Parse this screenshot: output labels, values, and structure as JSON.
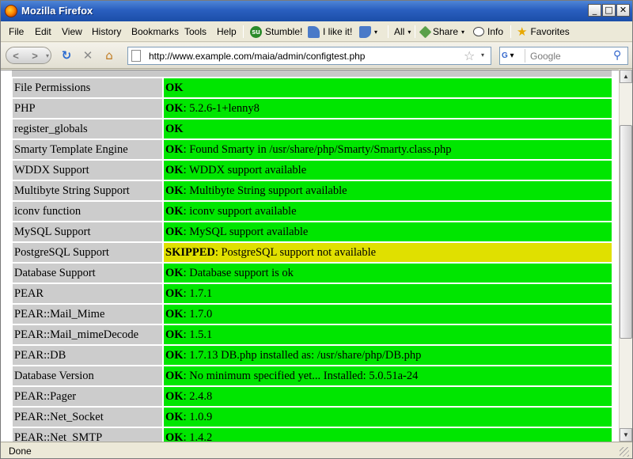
{
  "window": {
    "title": "Mozilla Firefox"
  },
  "menu": [
    "File",
    "Edit",
    "View",
    "History",
    "Bookmarks",
    "Tools",
    "Help"
  ],
  "toolbar": {
    "stumble": "Stumble!",
    "ilike": "I like it!",
    "all": "All",
    "share": "Share",
    "info": "Info",
    "favorites": "Favorites"
  },
  "nav": {
    "url": "http://www.example.com/maia/admin/configtest.php",
    "search_placeholder": "Google",
    "search_engine": "G"
  },
  "config_rows": [
    {
      "name": "File Permissions",
      "status": "OK",
      "detail": ""
    },
    {
      "name": "PHP",
      "status": "OK",
      "detail": ": 5.2.6-1+lenny8"
    },
    {
      "name": "register_globals",
      "status": "OK",
      "detail": ""
    },
    {
      "name": "Smarty Template Engine",
      "status": "OK",
      "detail": ": Found Smarty in /usr/share/php/Smarty/Smarty.class.php"
    },
    {
      "name": "WDDX Support",
      "status": "OK",
      "detail": ": WDDX support available"
    },
    {
      "name": "Multibyte String Support",
      "status": "OK",
      "detail": ": Multibyte String support available"
    },
    {
      "name": "iconv function",
      "status": "OK",
      "detail": ": iconv support available"
    },
    {
      "name": "MySQL Support",
      "status": "OK",
      "detail": ": MySQL support available"
    },
    {
      "name": "PostgreSQL Support",
      "status": "SKIPPED",
      "detail": ": PostgreSQL support not available"
    },
    {
      "name": "Database Support",
      "status": "OK",
      "detail": ": Database support is ok"
    },
    {
      "name": "PEAR",
      "status": "OK",
      "detail": ": 1.7.1"
    },
    {
      "name": "PEAR::Mail_Mime",
      "status": "OK",
      "detail": ": 1.7.0"
    },
    {
      "name": "PEAR::Mail_mimeDecode",
      "status": "OK",
      "detail": ": 1.5.1"
    },
    {
      "name": "PEAR::DB",
      "status": "OK",
      "detail": ": 1.7.13 DB.php installed as: /usr/share/php/DB.php"
    },
    {
      "name": "Database Version",
      "status": "OK",
      "detail": ": No minimum specified yet... Installed: 5.0.51a-24"
    },
    {
      "name": "PEAR::Pager",
      "status": "OK",
      "detail": ": 2.4.8"
    },
    {
      "name": "PEAR::Net_Socket",
      "status": "OK",
      "detail": ": 1.0.9"
    },
    {
      "name": "PEAR::Net_SMTP",
      "status": "OK",
      "detail": ": 1.4.2"
    }
  ],
  "colors": {
    "ok": "#00e600",
    "skipped": "#e0e000",
    "label_bg": "#cccccc"
  },
  "statusbar": {
    "text": "Done"
  }
}
